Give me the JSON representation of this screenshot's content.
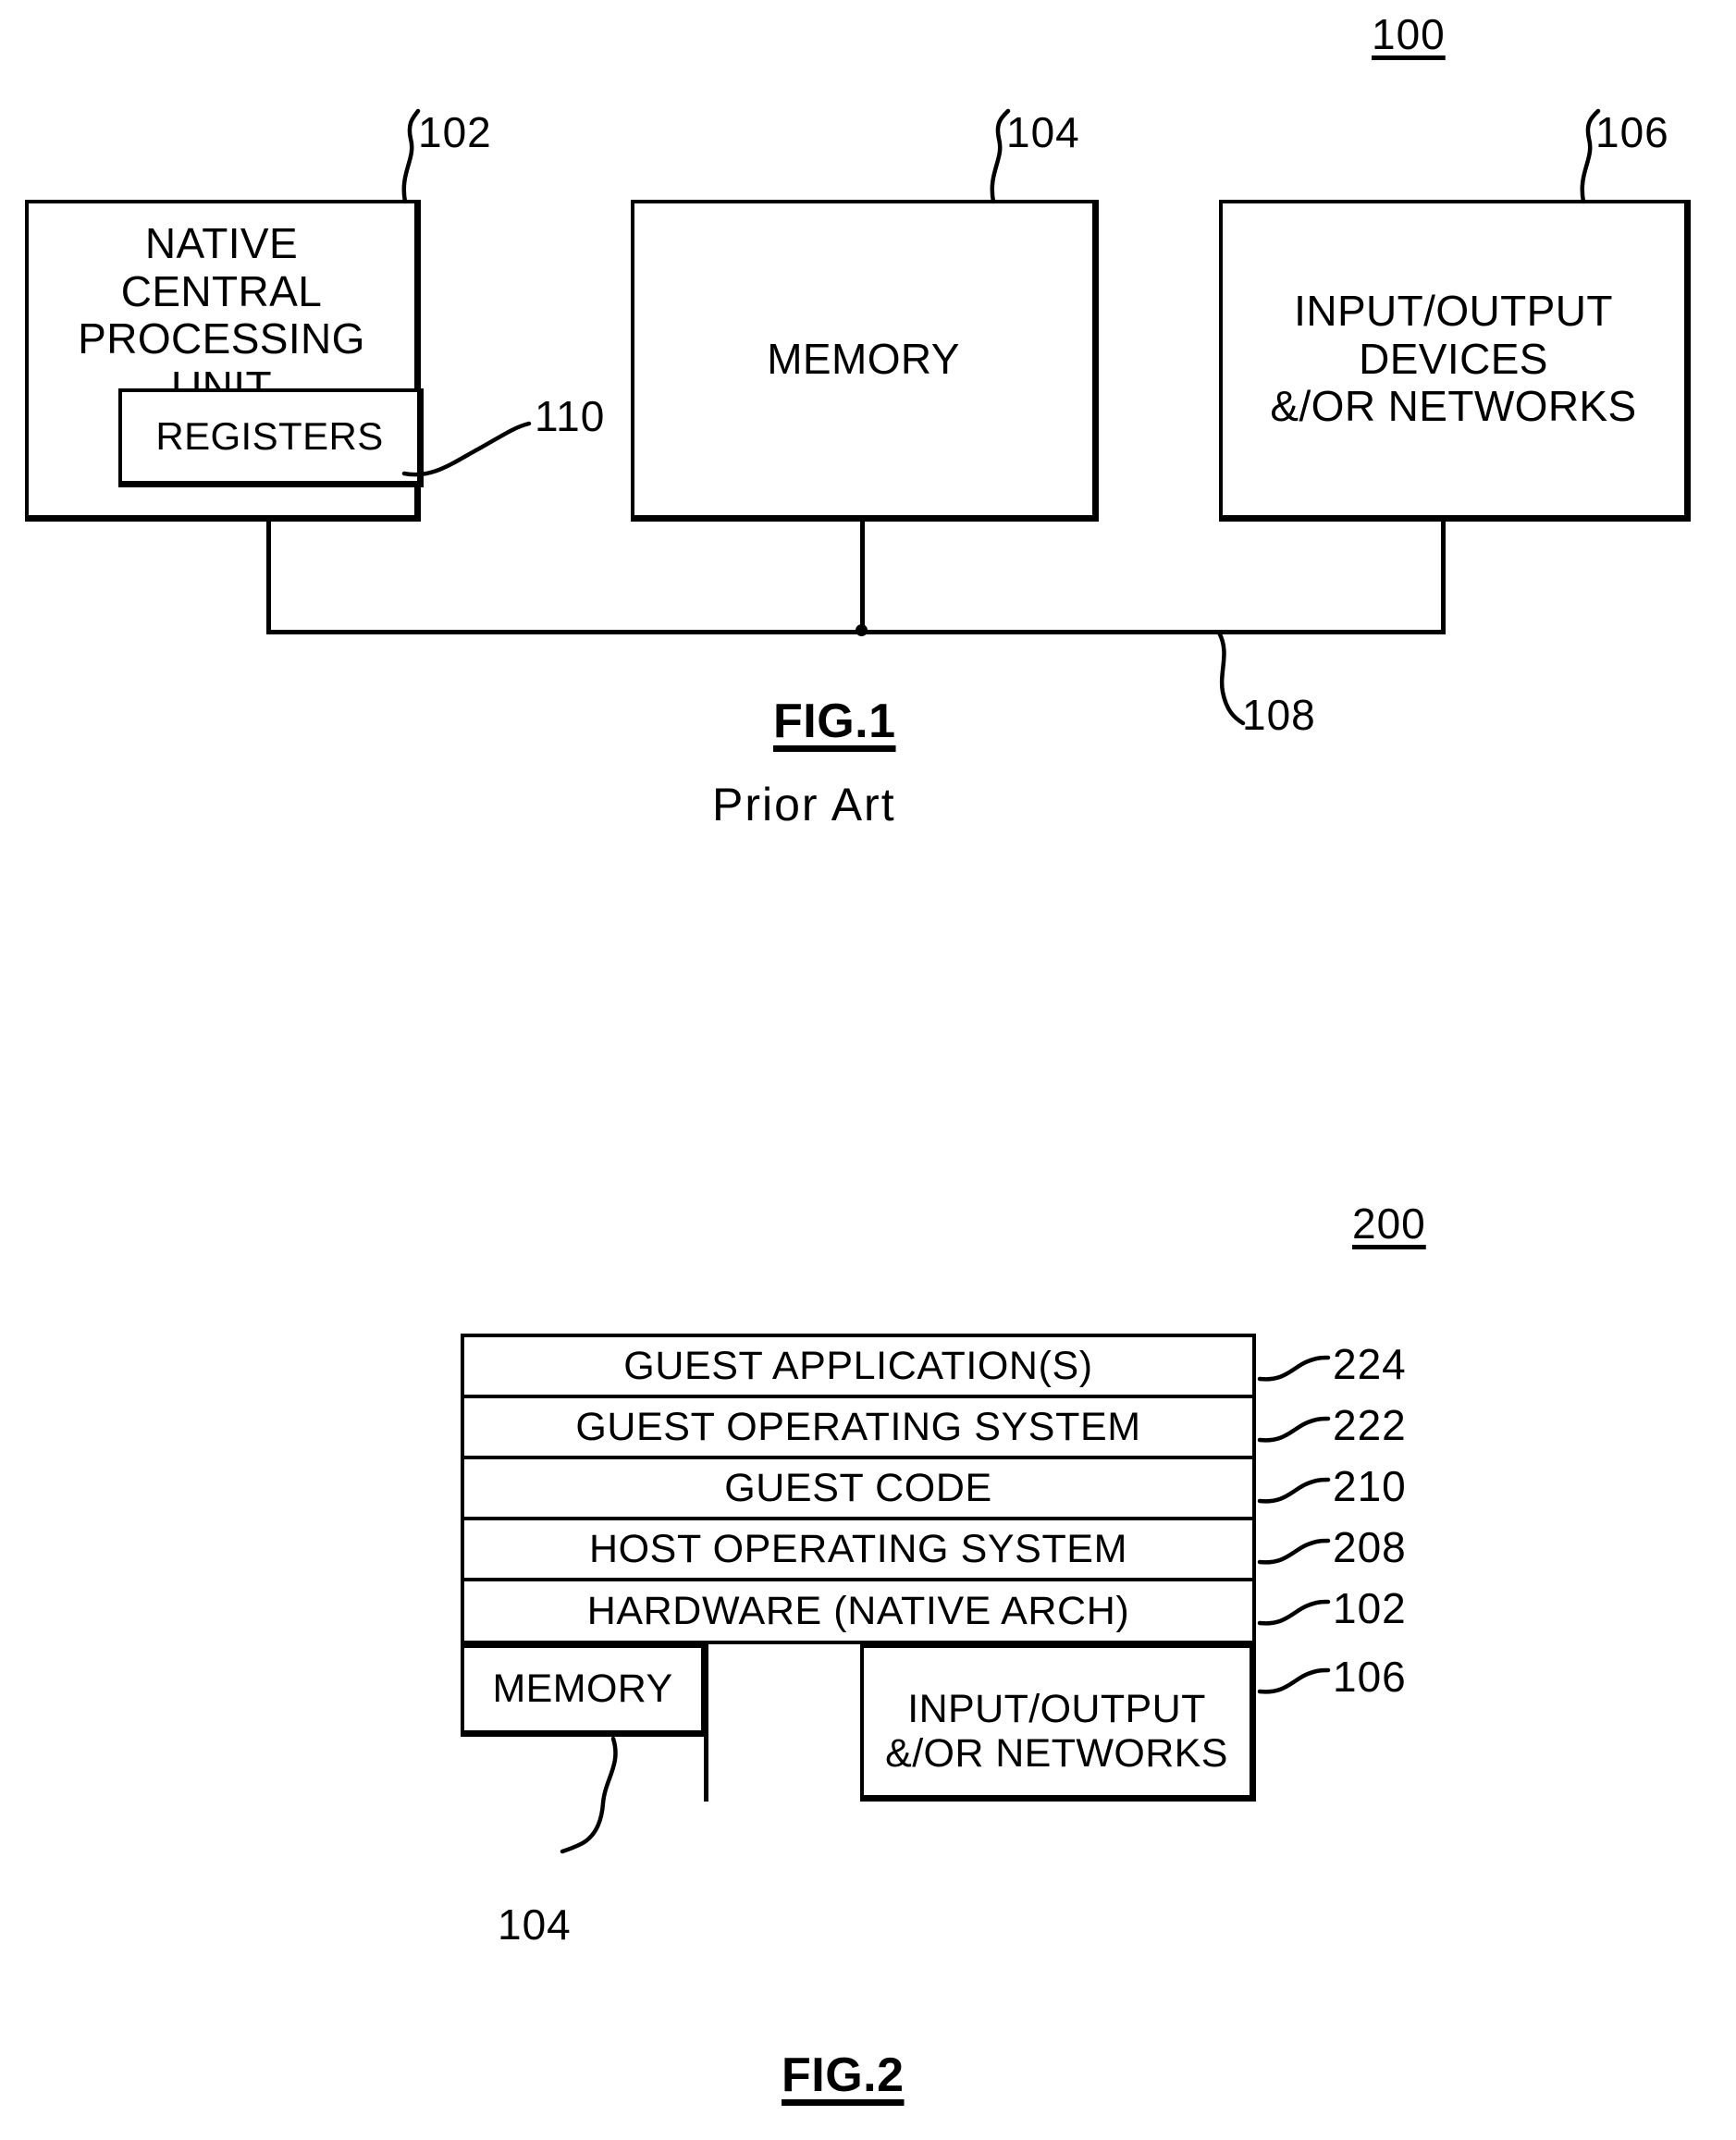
{
  "figures": [
    {
      "id": "fig1",
      "caption": "FIG.1",
      "subcaption": "Prior Art",
      "system_ref": "100",
      "blocks": {
        "cpu": {
          "label": "NATIVE\nCENTRAL\nPROCESSING  UNIT",
          "ref": "102"
        },
        "registers": {
          "label": "REGISTERS",
          "ref": "110"
        },
        "memory": {
          "label": "MEMORY",
          "ref": "104"
        },
        "io": {
          "label": "INPUT/OUTPUT\nDEVICES\n&/OR  NETWORKS",
          "ref": "106"
        },
        "bus": {
          "label": "",
          "ref": "108"
        }
      }
    },
    {
      "id": "fig2",
      "caption": "FIG.2",
      "system_ref": "200",
      "layers": [
        {
          "label": "GUEST APPLICATION(S)",
          "ref": "224"
        },
        {
          "label": "GUEST  OPERATING  SYSTEM",
          "ref": "222"
        },
        {
          "label": "GUEST  CODE",
          "ref": "210"
        },
        {
          "label": "HOST  OPERATING  SYSTEM",
          "ref": "208"
        },
        {
          "label": "HARDWARE  (NATIVE  ARCH)",
          "ref": "102"
        }
      ],
      "bottom": {
        "memory": {
          "label": "MEMORY",
          "ref": "104"
        },
        "io": {
          "label": "INPUT/OUTPUT\n&/OR  NETWORKS",
          "ref": "106"
        }
      }
    }
  ],
  "colors": {
    "ink": "#000000",
    "paper": "#ffffff"
  }
}
